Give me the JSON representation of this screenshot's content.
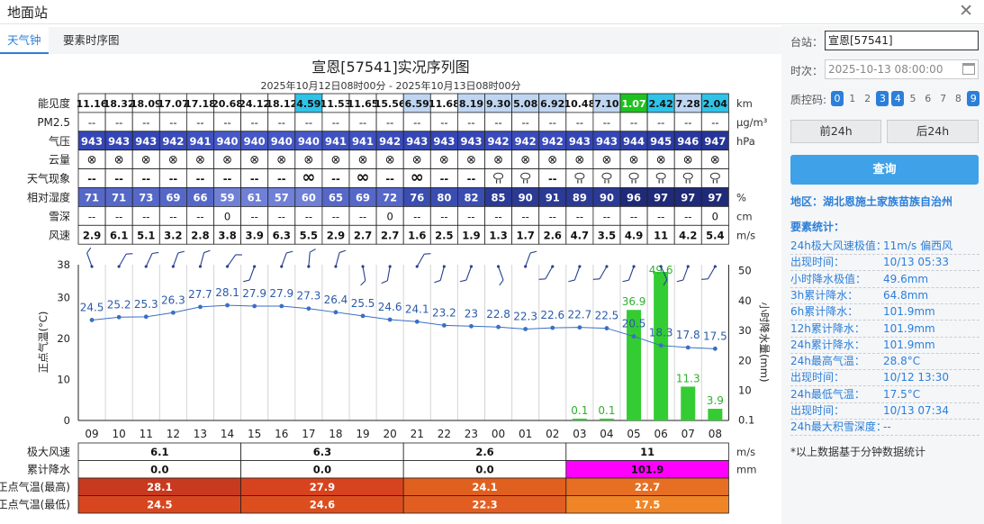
{
  "dialog": {
    "title": "地面站"
  },
  "tabs": [
    {
      "label": "天气钟"
    },
    {
      "label": "要素时序图"
    }
  ],
  "chart": {
    "title": "宣恩[57541]实况序列图",
    "subtitle": "2025年10月12日08时00分 - 2025年10月13日08时00分",
    "units": {
      "visibility": "km",
      "pm25": "μg/m³",
      "pressure": "hPa",
      "humidity": "%",
      "snow": "cm",
      "wind": "m/s"
    },
    "row_labels": [
      "能见度",
      "PM2.5",
      "气压",
      "云量",
      "天气现象",
      "相对湿度",
      "雪深",
      "风速"
    ],
    "hours": [
      "09",
      "10",
      "11",
      "12",
      "13",
      "14",
      "15",
      "16",
      "17",
      "18",
      "19",
      "20",
      "21",
      "22",
      "23",
      "00",
      "01",
      "02",
      "03",
      "04",
      "05",
      "06",
      "07",
      "08"
    ],
    "visibility": [
      "11.16",
      "18.32",
      "18.09",
      "17.07",
      "17.18",
      "20.68",
      "24.12",
      "18.12",
      "4.59",
      "11.53",
      "11.65",
      "15.56",
      "6.59",
      "11.68",
      "8.19",
      "9.30",
      "5.08",
      "6.92",
      "10.48",
      "7.10",
      "1.07",
      "2.42",
      "7.28",
      "2.04"
    ],
    "pm25": [
      "--",
      "--",
      "--",
      "--",
      "--",
      "--",
      "--",
      "--",
      "--",
      "--",
      "--",
      "--",
      "--",
      "--",
      "--",
      "--",
      "--",
      "--",
      "--",
      "--",
      "--",
      "--",
      "--",
      "--"
    ],
    "pressure": [
      "943",
      "943",
      "943",
      "942",
      "941",
      "940",
      "940",
      "940",
      "940",
      "941",
      "941",
      "942",
      "943",
      "943",
      "943",
      "942",
      "942",
      "942",
      "943",
      "943",
      "944",
      "945",
      "946",
      "947"
    ],
    "cloud": [
      "⊗",
      "⊗",
      "⊗",
      "⊗",
      "⊗",
      "⊗",
      "⊗",
      "⊗",
      "⊗",
      "⊗",
      "⊗",
      "⊗",
      "⊗",
      "⊗",
      "⊗",
      "⊗",
      "⊗",
      "⊗",
      "⊗",
      "⊗",
      "⊗",
      "⊗",
      "⊗",
      "⊗"
    ],
    "weather": [
      "--",
      "--",
      "--",
      "--",
      "--",
      "--",
      "--",
      "--",
      "∞",
      "--",
      "∞",
      "--",
      "∞",
      "--",
      "--",
      "rain-icon",
      "rain-icon",
      "--",
      "rain-icon",
      "rain-icon",
      "rain-icon",
      "rain-icon",
      "rain-icon",
      "rain-icon"
    ],
    "humidity": [
      "71",
      "71",
      "73",
      "69",
      "66",
      "59",
      "61",
      "57",
      "60",
      "65",
      "69",
      "72",
      "76",
      "80",
      "82",
      "85",
      "90",
      "91",
      "89",
      "90",
      "96",
      "97",
      "97",
      "97"
    ],
    "snow": [
      "--",
      "--",
      "--",
      "--",
      "--",
      "0",
      "--",
      "--",
      "--",
      "--",
      "--",
      "0",
      "--",
      "--",
      "--",
      "--",
      "--",
      "--",
      "--",
      "--",
      "--",
      "--",
      "--",
      "0"
    ],
    "wind": [
      "2.9",
      "6.1",
      "5.1",
      "3.2",
      "2.8",
      "3.8",
      "3.9",
      "6.3",
      "5.5",
      "2.9",
      "2.7",
      "2.7",
      "1.6",
      "2.5",
      "1.9",
      "1.3",
      "1.7",
      "2.6",
      "4.7",
      "3.5",
      "4.9",
      "11",
      "4.2",
      "5.4"
    ],
    "y_left_label": "正点气温(°C)",
    "y_right_label": "小时降水量(mm)",
    "y_left_ticks": [
      "38",
      "30",
      "20",
      "10",
      "0"
    ],
    "y_right_ticks": [
      "50",
      "40",
      "30",
      "20",
      "10",
      "0.1"
    ],
    "temp_labels": [
      "24.5",
      "25.2",
      "25.3",
      "26.3",
      "27.7",
      "28.1",
      "27.9",
      "27.9",
      "27.3",
      "26.4",
      "25.5",
      "24.6",
      "24.1",
      "23.2",
      "23",
      "22.8",
      "22.3",
      "22.6",
      "22.7",
      "22.5",
      "20.5",
      "18.3",
      "17.8",
      "17.5"
    ],
    "precip_labels": [
      "",
      "",
      "",
      "",
      "",
      "",
      "",
      "",
      "",
      "",
      "",
      "",
      "",
      "",
      "",
      "",
      "",
      "",
      "0.1",
      "0.1",
      "36.9",
      "49.6",
      "11.3",
      "3.9"
    ],
    "bottom": {
      "labels": [
        "极大风速",
        "累计降水",
        "正点气温(最高)",
        "正点气温(最低)"
      ],
      "units": [
        "m/s",
        "mm",
        "",
        ""
      ],
      "gust": [
        "6.1",
        "6.3",
        "2.6",
        "11"
      ],
      "rain": [
        "0.0",
        "0.0",
        "0.0",
        "101.9"
      ],
      "tmax": [
        "28.1",
        "27.9",
        "24.1",
        "22.7"
      ],
      "tmin": [
        "24.5",
        "24.6",
        "22.3",
        "17.5"
      ]
    },
    "colors": {
      "temp_line": "#3a6fc4",
      "precip_bar": "#33cc33",
      "rain_highlight": "#ff00ff"
    }
  },
  "chart_data": {
    "type": "line",
    "x": [
      "09",
      "10",
      "11",
      "12",
      "13",
      "14",
      "15",
      "16",
      "17",
      "18",
      "19",
      "20",
      "21",
      "22",
      "23",
      "00",
      "01",
      "02",
      "03",
      "04",
      "05",
      "06",
      "07",
      "08"
    ],
    "series": [
      {
        "name": "正点气温(°C)",
        "values": [
          24.5,
          25.2,
          25.3,
          26.3,
          27.7,
          28.1,
          27.9,
          27.9,
          27.3,
          26.4,
          25.5,
          24.6,
          24.1,
          23.2,
          23,
          22.8,
          22.3,
          22.6,
          22.7,
          22.5,
          20.5,
          18.3,
          17.8,
          17.5
        ]
      },
      {
        "name": "小时降水量(mm)",
        "type": "bar",
        "values": [
          0,
          0,
          0,
          0,
          0,
          0,
          0,
          0,
          0,
          0,
          0,
          0,
          0,
          0,
          0,
          0,
          0,
          0,
          0.1,
          0.1,
          36.9,
          49.6,
          11.3,
          3.9
        ]
      }
    ],
    "ylabel": "正点气温(°C)",
    "y2label": "小时降水量(mm)",
    "ylim": [
      0,
      38
    ],
    "y2lim": [
      0,
      50
    ]
  },
  "side": {
    "station_label": "台站：",
    "station_value": "宣恩[57541]",
    "time_label": "时次：",
    "time_value": "2025-10-13 08:00:00",
    "qc_label": "质控码:",
    "qc_codes": [
      "0",
      "1",
      "2",
      "3",
      "4",
      "5",
      "6",
      "7",
      "8",
      "9"
    ],
    "prev_label": "前24h",
    "next_label": "后24h",
    "query_label": "查询",
    "region": "地区：湖北恩施土家族苗族自治州",
    "stats_title": "要素统计：",
    "stats": [
      {
        "k": "24h极大风速极值：",
        "v": "11m/s 偏西风"
      },
      {
        "k": "出现时间：",
        "v": "10/13 05:33"
      },
      {
        "k": "小时降水极值：",
        "v": "49.6mm"
      },
      {
        "k": "3h累计降水：",
        "v": "64.8mm"
      },
      {
        "k": "6h累计降水：",
        "v": "101.9mm"
      },
      {
        "k": "12h累计降水：",
        "v": "101.9mm"
      },
      {
        "k": "24h累计降水：",
        "v": "101.9mm"
      },
      {
        "k": "24h最高气温：",
        "v": "28.8°C"
      },
      {
        "k": "出现时间：",
        "v": "10/12 13:30"
      },
      {
        "k": "24h最低气温：",
        "v": "17.5°C"
      },
      {
        "k": "出现时间：",
        "v": "10/13 07:34"
      },
      {
        "k": "24h最大积雪深度：",
        "v": "--"
      }
    ],
    "note": "*以上数据基于分钟数据统计"
  }
}
